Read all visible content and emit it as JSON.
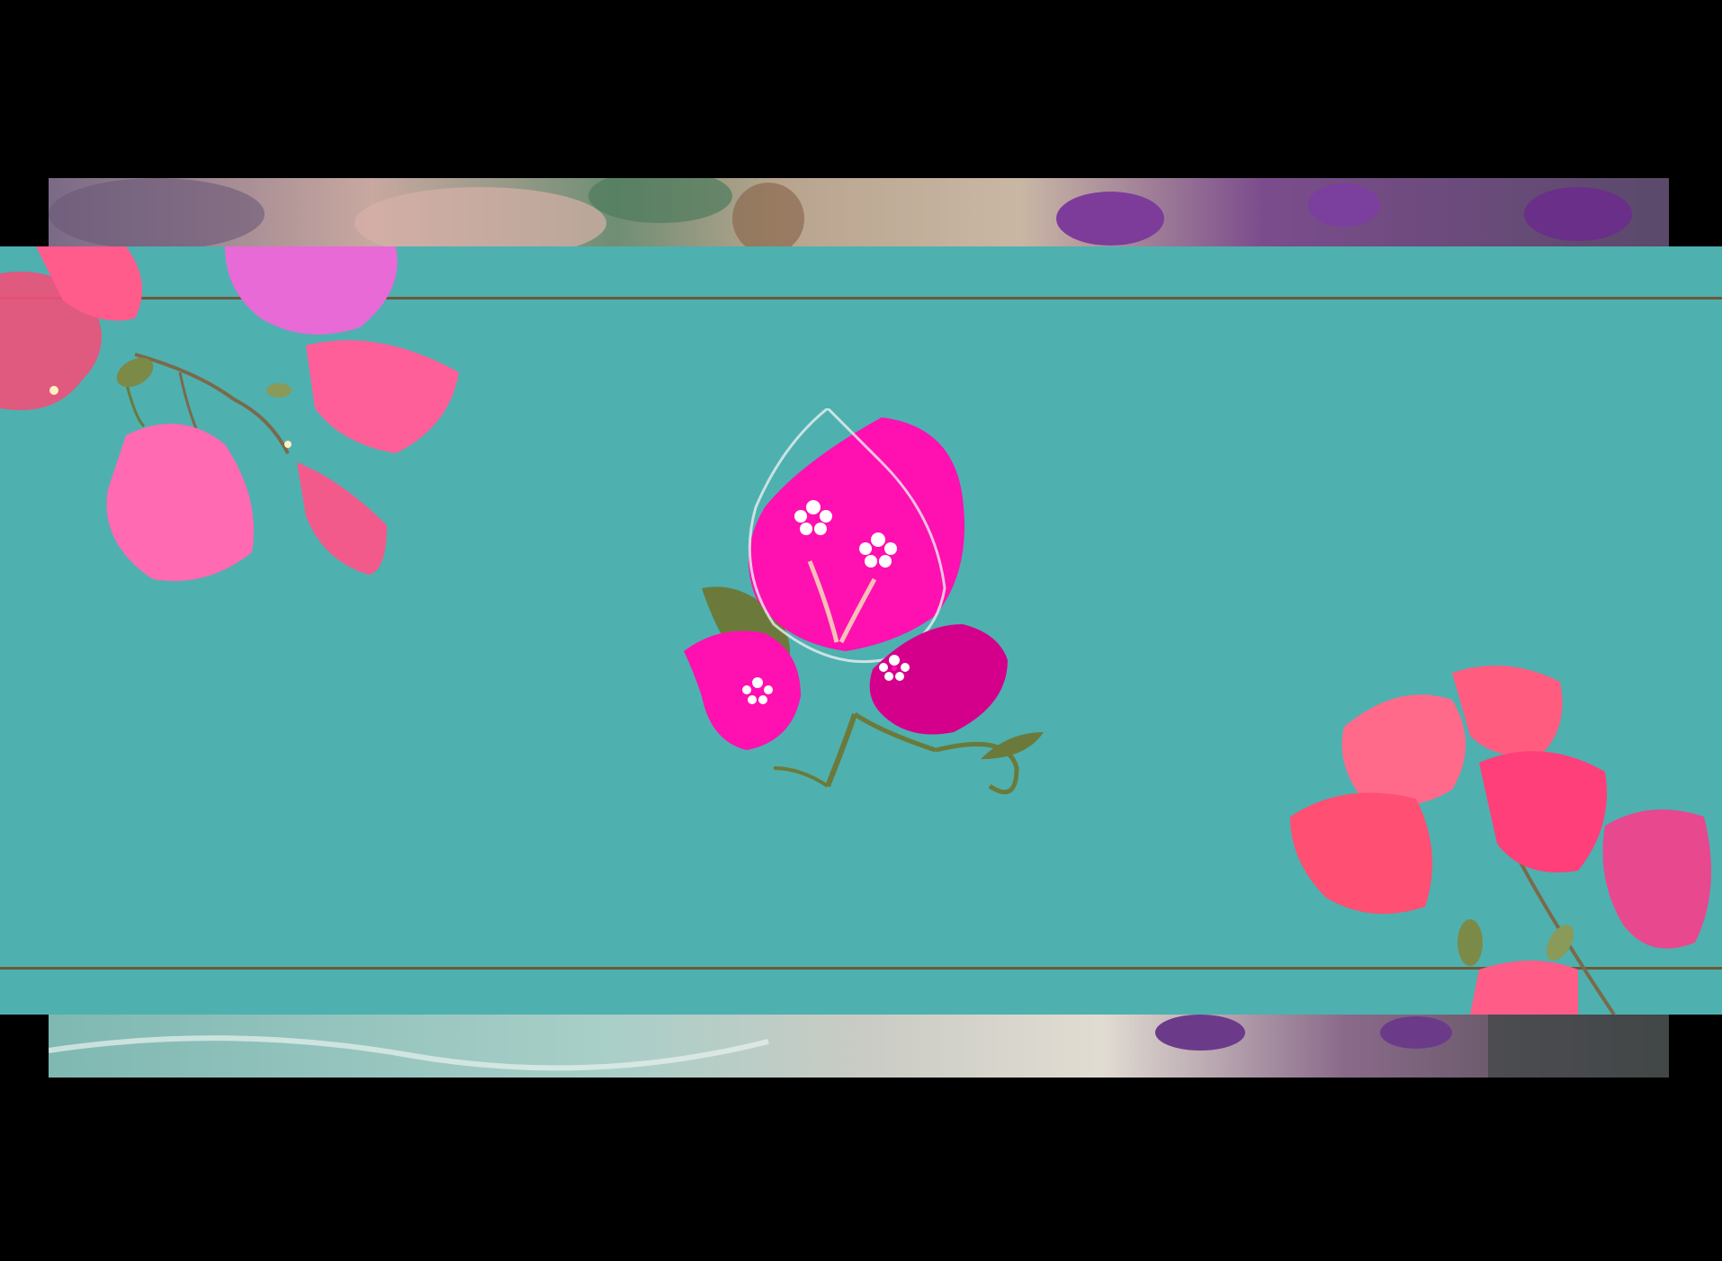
{
  "scene": {
    "background_color": "#000000",
    "band_color": "#4fb0b0",
    "rule_color": "#6b5a3a",
    "flower_colors": {
      "magenta": "#ff10b0",
      "deep_magenta": "#d4008c",
      "leaf": "#6b7a3a",
      "pink_photo": "#f0507a",
      "purple_photo": "#8a3a9a"
    }
  },
  "icons": {
    "logo": "bougainvillea-logo-icon",
    "corner_top_left": "bougainvillea-branch-icon",
    "corner_bottom_right": "bougainvillea-branch-icon"
  }
}
